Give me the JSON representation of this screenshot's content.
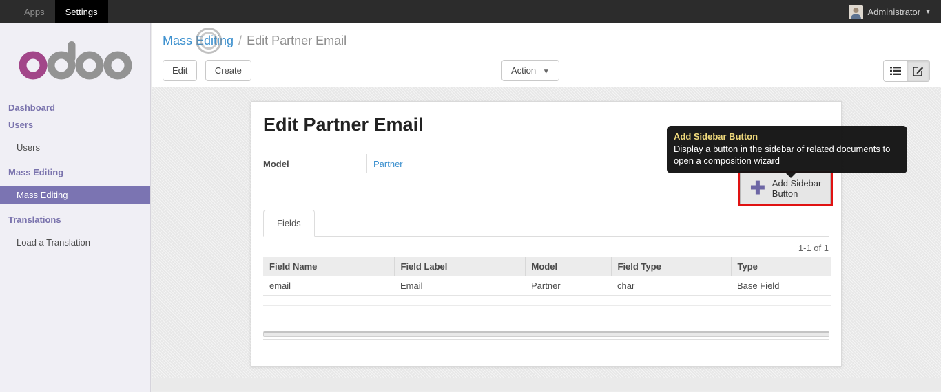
{
  "topbar": {
    "apps_label": "Apps",
    "settings_label": "Settings",
    "user_name": "Administrator"
  },
  "sidebar": {
    "logo_text": "odoo",
    "entries": [
      {
        "type": "header",
        "label": "Dashboard"
      },
      {
        "type": "header",
        "label": "Users"
      },
      {
        "type": "item",
        "label": "Users"
      },
      {
        "type": "header",
        "label": "Mass Editing"
      },
      {
        "type": "item",
        "label": "Mass Editing",
        "selected": true
      },
      {
        "type": "header",
        "label": "Translations"
      },
      {
        "type": "item",
        "label": "Load a Translation"
      }
    ]
  },
  "breadcrumb": {
    "parent": "Mass Editing",
    "separator": "/",
    "current": "Edit Partner Email"
  },
  "control": {
    "edit_label": "Edit",
    "create_label": "Create",
    "action_label": "Action"
  },
  "form": {
    "title": "Edit Partner Email",
    "model_label": "Model",
    "model_value": "Partner",
    "add_sidebar_button_label": "Add Sidebar Button",
    "tab_label": "Fields",
    "pager": "1-1 of 1"
  },
  "tooltip": {
    "title": "Add Sidebar Button",
    "body": "Display a button in the sidebar of related documents to open a composition wizard"
  },
  "table": {
    "columns": [
      "Field Name",
      "Field Label",
      "Model",
      "Field Type",
      "Type"
    ],
    "rows": [
      {
        "cells": [
          "email",
          "Email",
          "Partner",
          "char",
          "Base Field"
        ]
      }
    ]
  },
  "colors": {
    "accent_purple": "#7b74b2",
    "logo_magenta": "#a24689",
    "link_blue": "#3a8fce",
    "tooltip_title_gold": "#eed87b",
    "highlight_red": "#e01212"
  }
}
